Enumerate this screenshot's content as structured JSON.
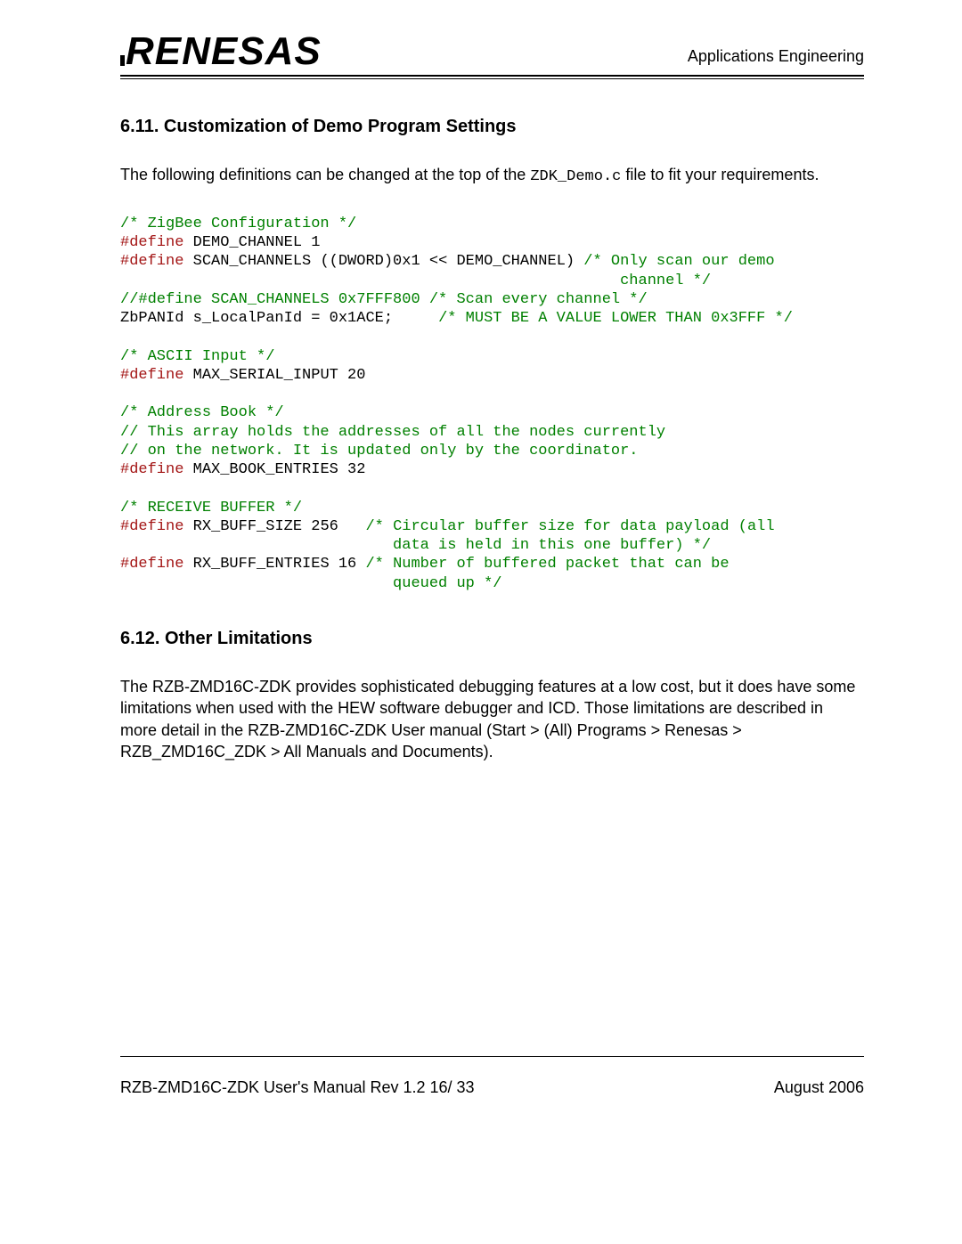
{
  "header": {
    "brand": "RENESAS",
    "right": "Applications Engineering"
  },
  "section611": {
    "heading": "6.11. Customization of Demo Program Settings",
    "intro_before": "The following definitions can be changed at the top of the ",
    "intro_code": "ZDK_Demo.c",
    "intro_after": " file to fit your requirements."
  },
  "code": {
    "l01": "/* ZigBee Configuration */",
    "l02a": "#define",
    "l02b": " DEMO_CHANNEL 1",
    "l03a": "#define",
    "l03b": " SCAN_CHANNELS ((DWORD)0x1 << DEMO_CHANNEL) ",
    "l03c": "/* Only scan our demo",
    "l04": "                                                       channel */",
    "l05": "//#define SCAN_CHANNELS 0x7FFF800 /* Scan every channel */",
    "l06a": "ZbPANId s_LocalPanId = 0x1ACE;     ",
    "l06b": "/* MUST BE A VALUE LOWER THAN 0x3FFF */",
    "l07": "",
    "l08": "/* ASCII Input */",
    "l09a": "#define",
    "l09b": " MAX_SERIAL_INPUT 20",
    "l10": "",
    "l11": "/* Address Book */",
    "l12": "// This array holds the addresses of all the nodes currently",
    "l13": "// on the network. It is updated only by the coordinator.",
    "l14a": "#define",
    "l14b": " MAX_BOOK_ENTRIES 32",
    "l15": "",
    "l16": "/* RECEIVE BUFFER */",
    "l17a": "#define",
    "l17b": " RX_BUFF_SIZE 256   ",
    "l17c": "/* Circular buffer size for data payload (all",
    "l18": "                              data is held in this one buffer) */",
    "l19a": "#define",
    "l19b": " RX_BUFF_ENTRIES 16 ",
    "l19c": "/* Number of buffered packet that can be",
    "l20": "                              queued up */"
  },
  "section612": {
    "heading": "6.12. Other Limitations",
    "body": "The RZB-ZMD16C-ZDK provides sophisticated debugging features at a low cost, but it does have some limitations when used with the HEW software debugger and ICD. Those limitations are described in more detail in the RZB-ZMD16C-ZDK User manual (Start > (All) Programs > Renesas > RZB_ZMD16C_ZDK > All Manuals and Documents)."
  },
  "footer": {
    "left": "RZB-ZMD16C-ZDK User's Manual Rev 1.2    16/ 33",
    "right": "August 2006"
  }
}
